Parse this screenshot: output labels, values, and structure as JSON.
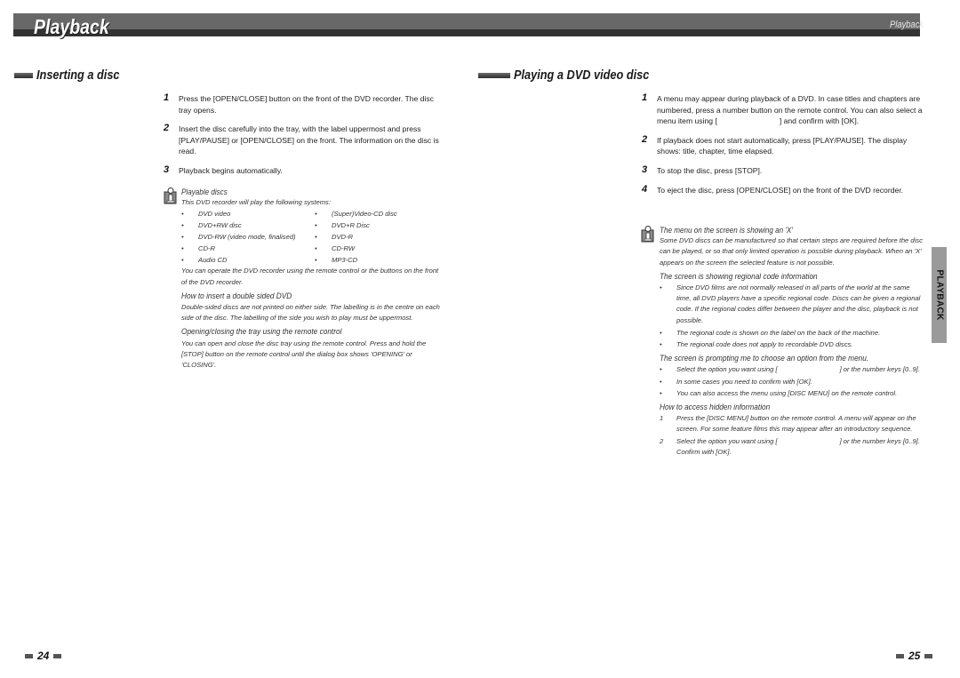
{
  "header": {
    "title": "Playback",
    "right_title": "Playback",
    "colors": {
      "bar": "#686868",
      "stripe": "#333333"
    }
  },
  "left": {
    "section_title": "Inserting a disc",
    "steps": [
      {
        "num": "1",
        "text": "Press the [OPEN/CLOSE] button on the front of the DVD recorder. The disc tray opens."
      },
      {
        "num": "2",
        "text": "Insert the disc carefully into the tray, with the label uppermost and press [PLAY/PAUSE] or [OPEN/CLOSE] on the front. The information on the disc is read."
      },
      {
        "num": "3",
        "text": "Playback begins automatically."
      }
    ],
    "note": {
      "icon": "info-icon",
      "title": "Playable discs",
      "intro": "This DVD recorder will play the following systems:",
      "discs": [
        "DVD video",
        "(Super)Video-CD disc",
        "DVD+RW disc",
        "DVD+R Disc",
        "DVD-RW (video mode, finalised)",
        "DVD-R",
        "CD-R",
        "CD-RW",
        "Audio CD",
        "MP3-CD"
      ],
      "remote_text": "You can operate the DVD recorder using the remote control or the buttons on the front of the DVD recorder.",
      "double_sided_title": "How to insert a double sided DVD",
      "double_sided_text": "Double-sided discs are not printed on either side. The labelling is in the centre on each side of the disc. The labelling of the side you wish to play must be uppermost.",
      "tray_title": "Opening/closing the tray using the remote control",
      "tray_text": "You can open and close the disc tray using the remote control. Press and hold the [STOP] button on the remote control until the dialog box shows 'OPENING' or 'CLOSING'."
    },
    "page_number": "24"
  },
  "right": {
    "section_title": "Playing a DVD video disc",
    "steps": [
      {
        "num": "1",
        "text_a": "A menu may appear during playback of a DVD. In case titles and chapters are numbered, press a number button on the remote control. You can also select a menu item using [",
        "text_b": "] and confirm with [OK]."
      },
      {
        "num": "2",
        "text": "If playback does not start automatically, press [PLAY/PAUSE]. The display shows: title, chapter, time elapsed."
      },
      {
        "num": "3",
        "text": "To stop the disc, press [STOP]."
      },
      {
        "num": "4",
        "text": "To eject the disc, press [OPEN/CLOSE] on the front of the DVD recorder."
      }
    ],
    "note": {
      "icon": "info-icon",
      "title": "The menu on the screen is showing an 'X'",
      "x_text": "Some DVD discs can be manufactured so that certain steps are required before the disc can be played, or so that only limited operation is possible during playback. When an 'X' appears on the screen the selected feature is not possible.",
      "regional_title": "The screen is showing regional code information",
      "regional_bullets": [
        "Since DVD films are not normally released in all parts of the world at the same time, all DVD players have a specific regional code. Discs can be given a regional code. If the regional codes differ between the player and the disc, playback is not possible.",
        "The regional code is shown on the label on the back of the machine.",
        "The regional code does not apply to recordable DVD discs."
      ],
      "prompt_title": "The screen is prompting me to choose an option from the menu.",
      "prompt_bullets": [
        {
          "a": "Select the option you want using [",
          "b": "] or the number keys [0..9]."
        },
        {
          "a": "In some cases you need to confirm with [OK].",
          "b": ""
        },
        {
          "a": "You can also access the menu using [DISC MENU] on the remote control.",
          "b": ""
        }
      ],
      "hidden_title": "How to access hidden information",
      "hidden_steps": [
        {
          "n": "1",
          "a": "Press the [DISC MENU] button on the remote control. A menu will appear on the screen. For some feature films this may appear after an introductory sequence.",
          "b": ""
        },
        {
          "n": "2",
          "a": "Select the option you want using [",
          "b": "] or the number keys [0..9]. Confirm with [OK]."
        }
      ]
    },
    "side_tab": "PLAYBACK",
    "page_number": "25"
  }
}
